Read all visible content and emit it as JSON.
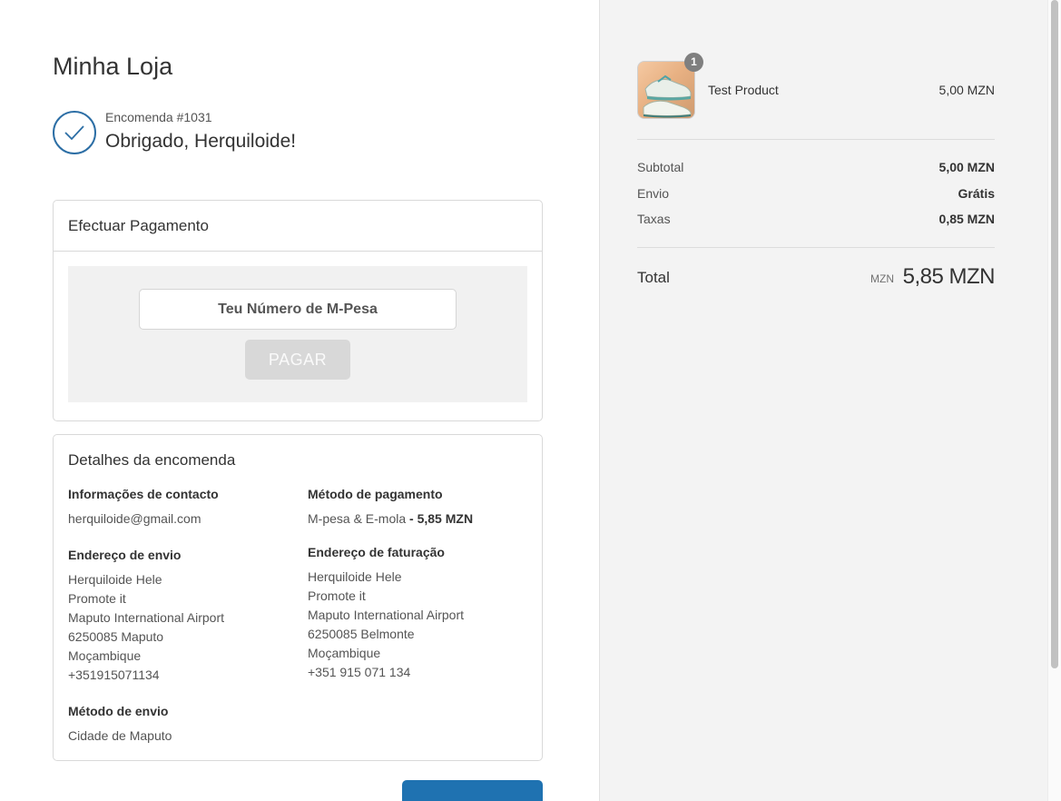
{
  "store": {
    "name": "Minha Loja"
  },
  "confirmation": {
    "order_number": "Encomenda #1031",
    "thanks": "Obrigado, Herquiloide!",
    "icon": "check-circle-icon"
  },
  "payment_card": {
    "title": "Efectuar Pagamento",
    "input_placeholder": "Teu Número de M-Pesa",
    "pay_button": "PAGAR"
  },
  "details": {
    "title": "Detalhes da encomenda",
    "contact": {
      "title": "Informações de contacto",
      "email": "herquiloide@gmail.com"
    },
    "payment_method": {
      "title": "Método de pagamento",
      "method": "M-pesa & E-mola",
      "amount": " - 5,85 MZN"
    },
    "shipping_address": {
      "title": "Endereço de envio",
      "lines": [
        "Herquiloide Hele",
        "Promote it",
        "Maputo International Airport",
        "6250085 Maputo",
        "Moçambique",
        "+351915071134"
      ]
    },
    "billing_address": {
      "title": "Endereço de faturação",
      "lines": [
        "Herquiloide Hele",
        "Promote it",
        "Maputo International Airport",
        "6250085 Belmonte",
        "Moçambique",
        "+351 915 071 134"
      ]
    },
    "shipping_method": {
      "title": "Método de envio",
      "value": "Cidade de Maputo"
    }
  },
  "summary": {
    "product": {
      "name": "Test Product",
      "price": "5,00 MZN",
      "quantity": "1",
      "image": "sneaker-image"
    },
    "rows": [
      {
        "label": "Subtotal",
        "value": "5,00 MZN"
      },
      {
        "label": "Envio",
        "value": "Grátis"
      },
      {
        "label": "Taxas",
        "value": "0,85 MZN"
      }
    ],
    "total": {
      "label": "Total",
      "currency": "MZN",
      "value": "5,85 MZN"
    }
  },
  "colors": {
    "accent": "#2c6ea5",
    "primary_button": "#1f72b1",
    "disabled_button": "#d8d8d8",
    "sidebar_bg": "#f3f3f3"
  }
}
